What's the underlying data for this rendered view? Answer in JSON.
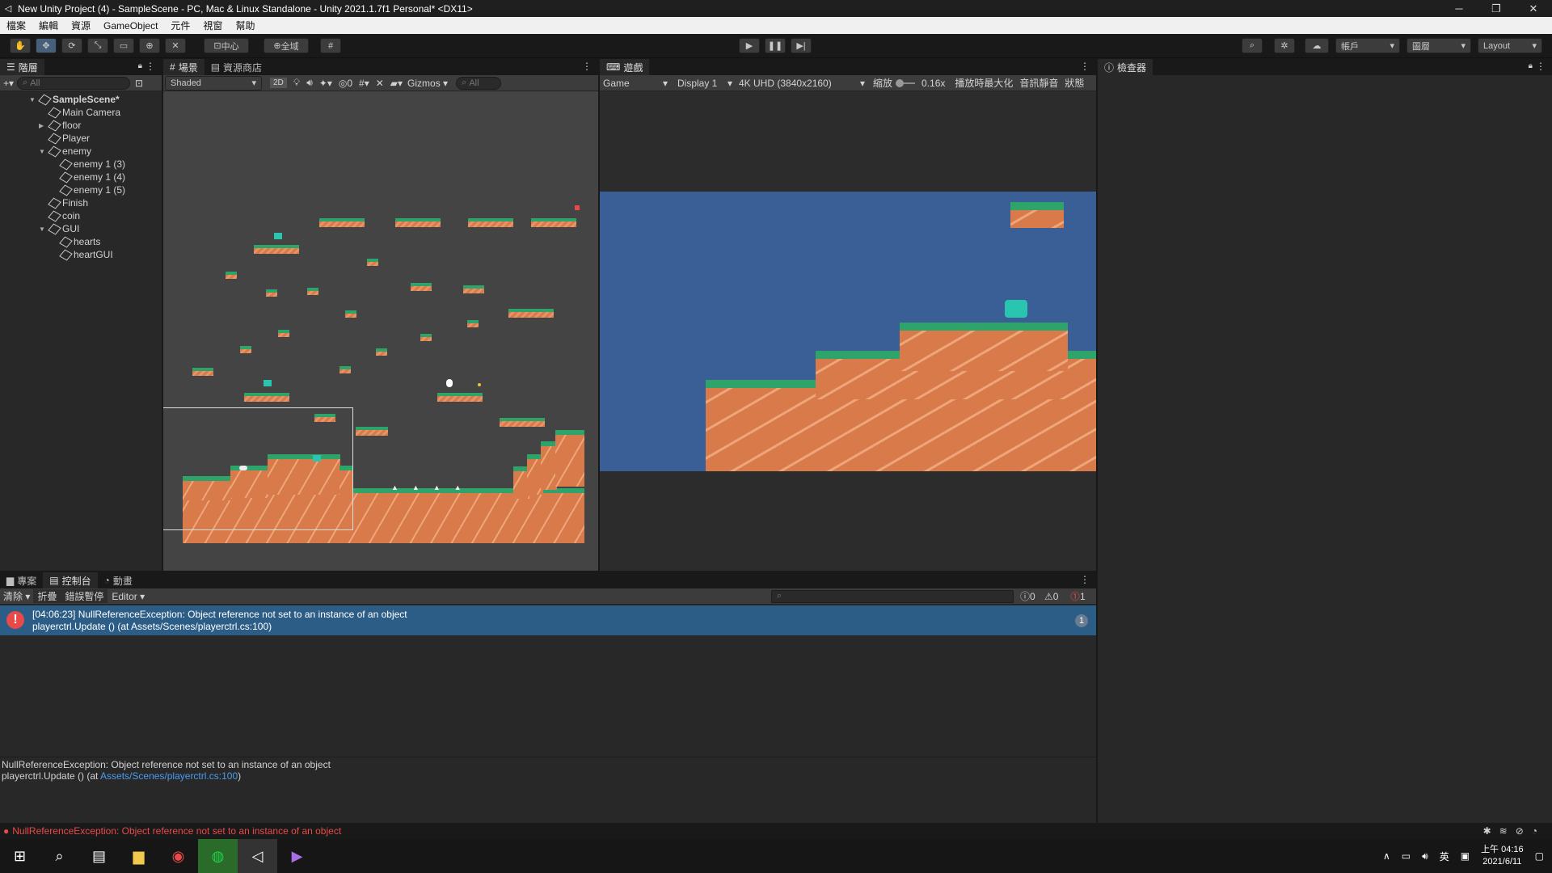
{
  "window": {
    "title": "New Unity Project (4) - SampleScene - PC, Mac & Linux Standalone - Unity 2021.1.7f1 Personal* <DX11>"
  },
  "menu": [
    "檔案",
    "編輯",
    "資源",
    "GameObject",
    "元件",
    "視窗",
    "幫助"
  ],
  "toolbar": {
    "pivot": "中心",
    "global": "全域",
    "account": "帳戶",
    "layers": "圖層",
    "layout": "Layout"
  },
  "hierarchy": {
    "tab": "階層",
    "search_placeholder": "All",
    "items": [
      {
        "name": "SampleScene*",
        "level": 0,
        "arrow": "▼",
        "scene": true
      },
      {
        "name": "Main Camera",
        "level": 1,
        "arrow": ""
      },
      {
        "name": "floor",
        "level": 1,
        "arrow": "▶"
      },
      {
        "name": "Player",
        "level": 1,
        "arrow": ""
      },
      {
        "name": "enemy",
        "level": 1,
        "arrow": "▼"
      },
      {
        "name": "enemy 1 (3)",
        "level": 2,
        "arrow": ""
      },
      {
        "name": "enemy 1 (4)",
        "level": 2,
        "arrow": ""
      },
      {
        "name": "enemy 1 (5)",
        "level": 2,
        "arrow": ""
      },
      {
        "name": "Finish",
        "level": 1,
        "arrow": ""
      },
      {
        "name": "coin",
        "level": 1,
        "arrow": ""
      },
      {
        "name": "GUI",
        "level": 1,
        "arrow": "▼"
      },
      {
        "name": "hearts",
        "level": 2,
        "arrow": ""
      },
      {
        "name": "heartGUI",
        "level": 2,
        "arrow": ""
      }
    ]
  },
  "scene": {
    "tab": "場景",
    "store_tab": "資源商店",
    "shading": "Shaded",
    "mode2d": "2D",
    "hidden_count": "0",
    "gizmos": "Gizmos",
    "search": "All"
  },
  "game": {
    "tab": "遊戲",
    "view": "Game",
    "display": "Display 1",
    "resolution": "4K UHD (3840x2160)",
    "scale_label": "縮放",
    "scale_value": "0.16x",
    "maximize": "播放時最大化",
    "mute": "音訊靜音",
    "stats": "狀態"
  },
  "inspector": {
    "tab": "檢查器"
  },
  "bottom": {
    "tabs": [
      "專案",
      "控制台",
      "動畫"
    ],
    "clear": "清除",
    "collapse": "折疊",
    "error_pause": "錯誤暫停",
    "editor": "Editor",
    "counts": {
      "info": "0",
      "warn": "0",
      "error": "1"
    }
  },
  "console": {
    "line1": "[04:06:23] NullReferenceException: Object reference not set to an instance of an object",
    "line2": "playerctrl.Update () (at Assets/Scenes/playerctrl.cs:100)",
    "badge": "1",
    "detail1": "NullReferenceException: Object reference not set to an instance of an object",
    "detail2_prefix": "playerctrl.Update () (at ",
    "detail2_link": "Assets/Scenes/playerctrl.cs:100",
    "detail2_suffix": ")"
  },
  "status": {
    "message": "NullReferenceException: Object reference not set to an instance of an object"
  },
  "taskbar": {
    "time": "上午 04:16",
    "date": "2021/6/11",
    "ime": "英"
  },
  "colors": {
    "accent": "#2c5d87",
    "error": "#e84a4a",
    "link": "#4c9bf0",
    "sky": "#3a5f96",
    "grass": "#2ea36a",
    "dirt": "#d87a4a"
  }
}
